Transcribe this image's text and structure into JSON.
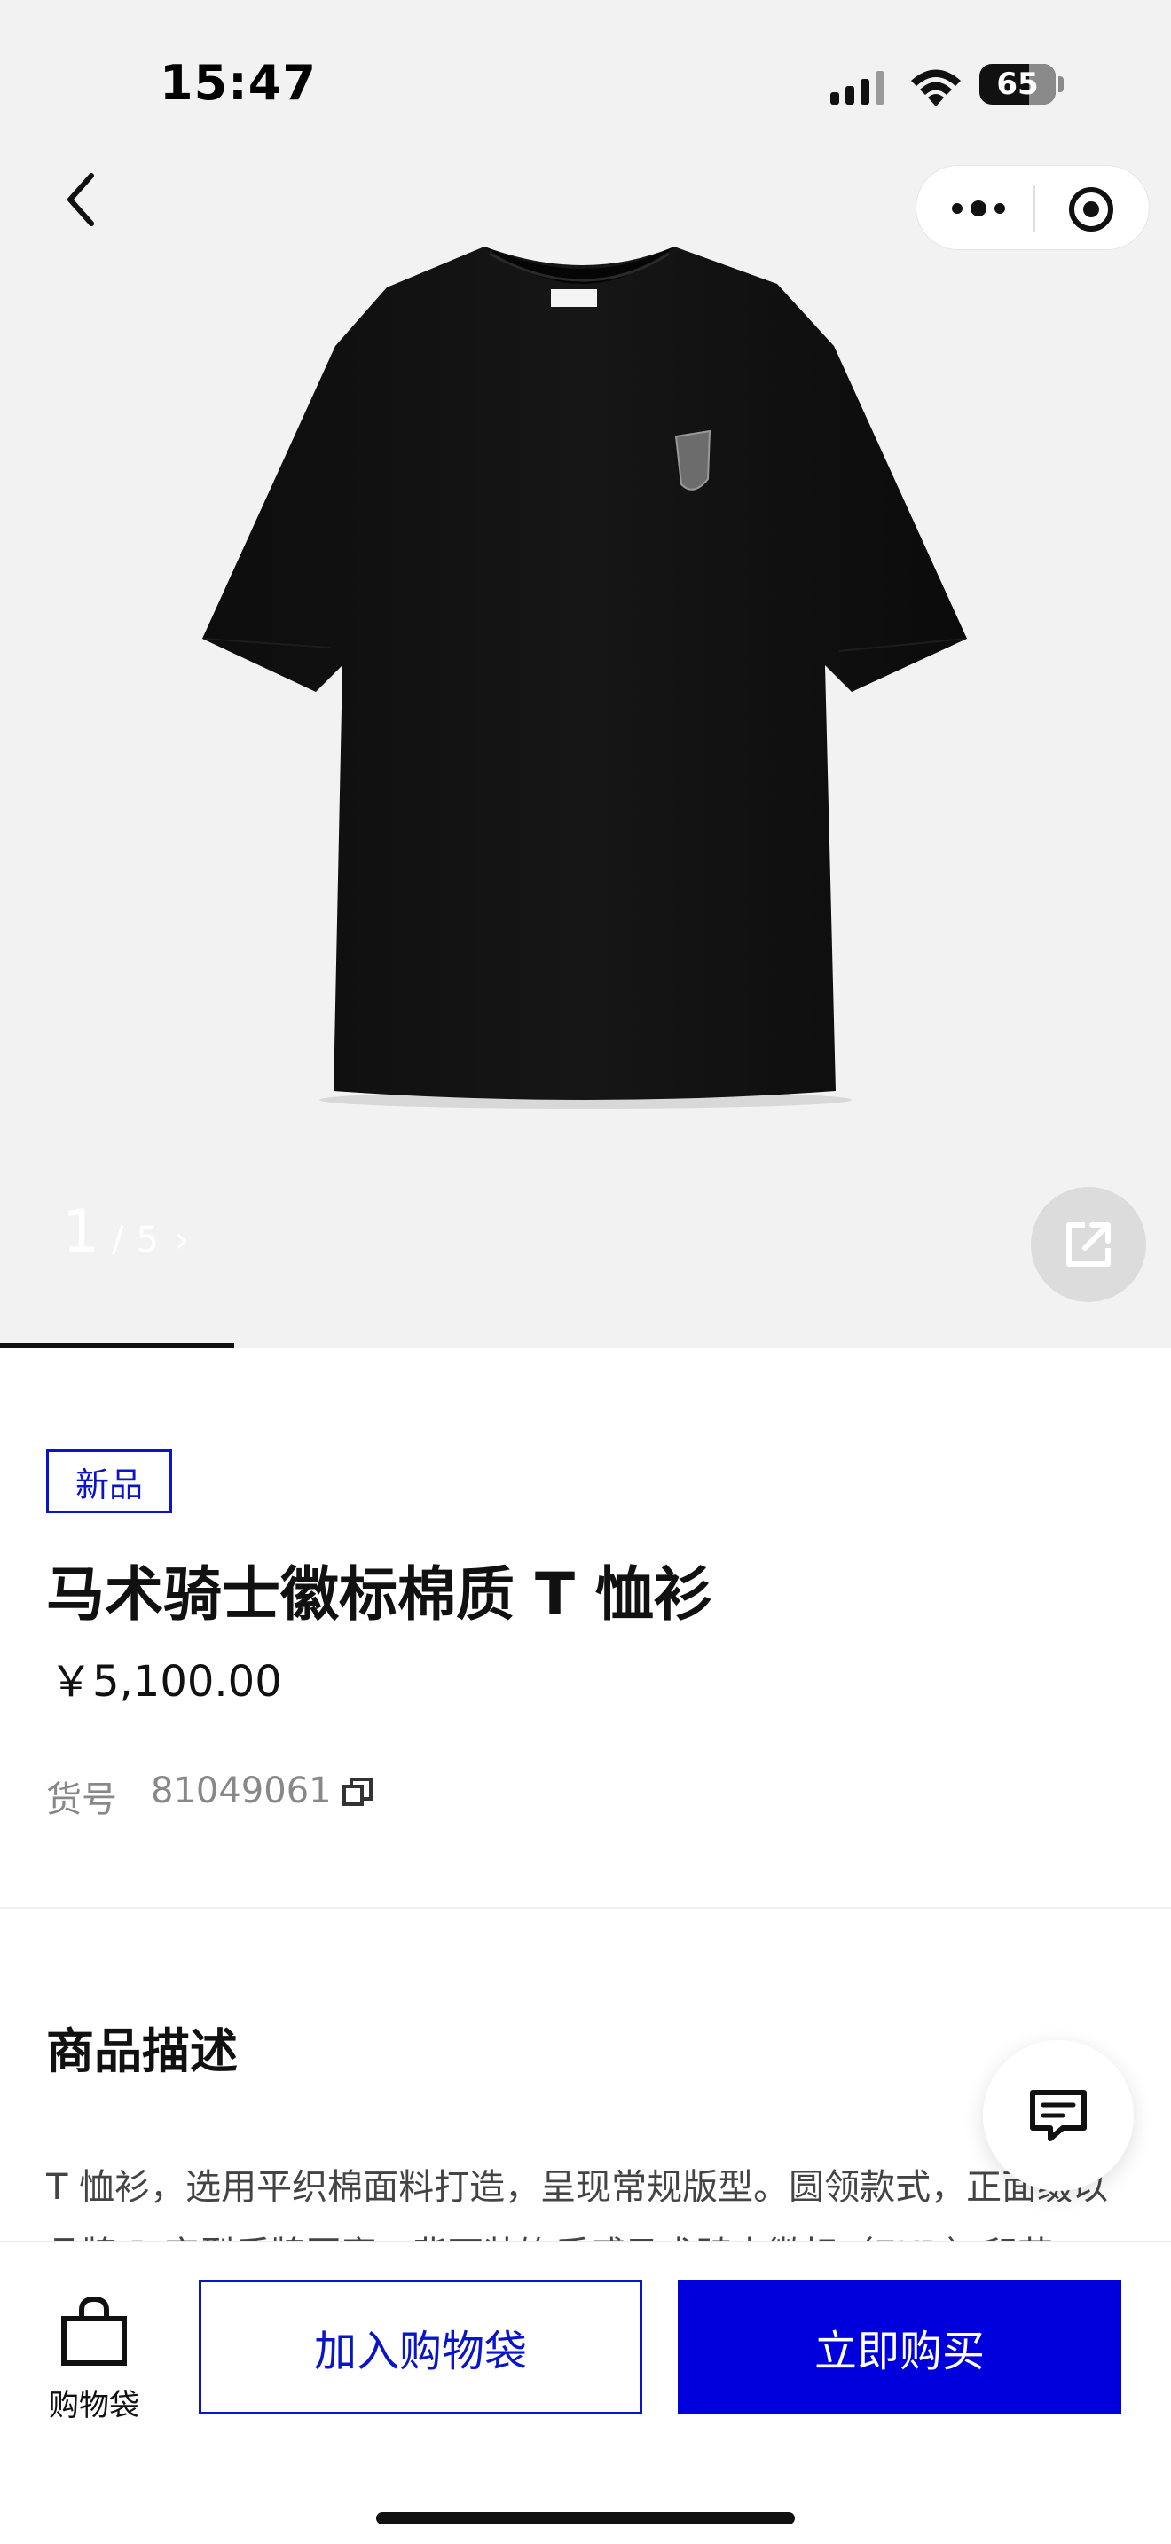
{
  "status_bar": {
    "time": "15:47",
    "battery": "65",
    "icons": [
      "cellular-signal-icon",
      "wifi-icon",
      "battery-icon"
    ]
  },
  "nav": {
    "back_icon": "chevron-left-icon",
    "capsule_icons": [
      "more-dots-icon",
      "target-circle-icon"
    ]
  },
  "gallery": {
    "current": "1",
    "separator": "/",
    "total": "5",
    "next_icon": "chevron-right-icon",
    "share_icon": "share-external-icon",
    "progress": 0.2
  },
  "product": {
    "badge": "新品",
    "title": "马术骑士徽标棉质 T 恤衫",
    "price": "￥5,100.00",
    "sku_label": "货号",
    "sku_value": "81049061"
  },
  "description": {
    "heading": "商品描述",
    "text": "T 恤衫，选用平织棉面料打造，呈现常规版型。圆领款式，正面缀以品牌 B 字型质牌图案，背面装饰质感马术骑士徽标（EKD）印花"
  },
  "bottom_bar": {
    "bag_label": "购物袋",
    "add_to_bag": "加入购物袋",
    "buy_now": "立即购买"
  },
  "colors": {
    "accent_blue": "#0000dc",
    "badge_blue": "#0a14c8",
    "hero_bg": "#f2f2f2"
  }
}
